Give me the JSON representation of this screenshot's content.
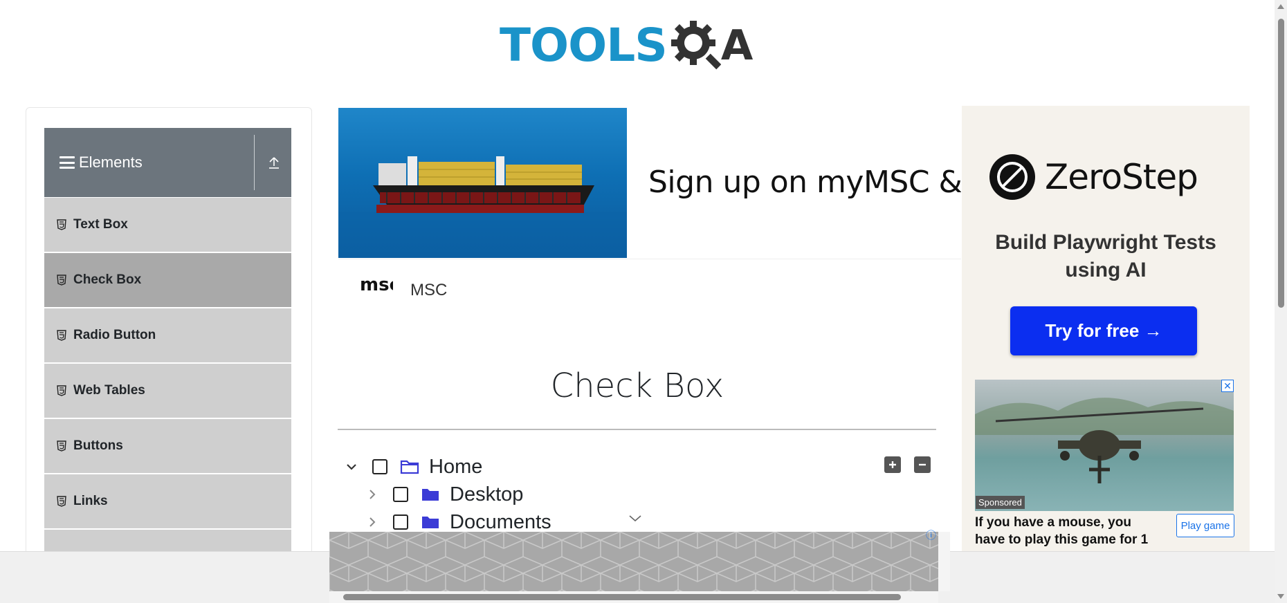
{
  "header": {
    "logo_text_left": "TOOLS",
    "logo_text_right": "A"
  },
  "sidebar": {
    "group_title": "Elements",
    "items": [
      {
        "label": "Text Box",
        "active": false
      },
      {
        "label": "Check Box",
        "active": true
      },
      {
        "label": "Radio Button",
        "active": false
      },
      {
        "label": "Web Tables",
        "active": false
      },
      {
        "label": "Buttons",
        "active": false
      },
      {
        "label": "Links",
        "active": false
      }
    ]
  },
  "ad_banner": {
    "headline": "Sign up on myMSC & B",
    "brand_mark": "msc",
    "brand_name": "MSC"
  },
  "main": {
    "title": "Check Box",
    "tree": [
      {
        "label": "Home",
        "expanded": true,
        "level": 0
      },
      {
        "label": "Desktop",
        "expanded": false,
        "level": 1
      },
      {
        "label": "Documents",
        "expanded": false,
        "level": 1
      }
    ]
  },
  "right_ad": {
    "brand": "ZeroStep",
    "tagline": "Build Playwright Tests using AI",
    "cta": "Try for free →",
    "sponsored_label": "Sponsored",
    "game_text": "If you have a mouse, you have to play this game for 1",
    "game_button": "Play game"
  },
  "colors": {
    "accent": "#1a93c9",
    "sidebar_header": "#6c757d",
    "menu_item": "#cfcfcf",
    "menu_item_active": "#a9a9a9",
    "cta": "#0b2ef0",
    "folder": "#3b3bd6"
  }
}
